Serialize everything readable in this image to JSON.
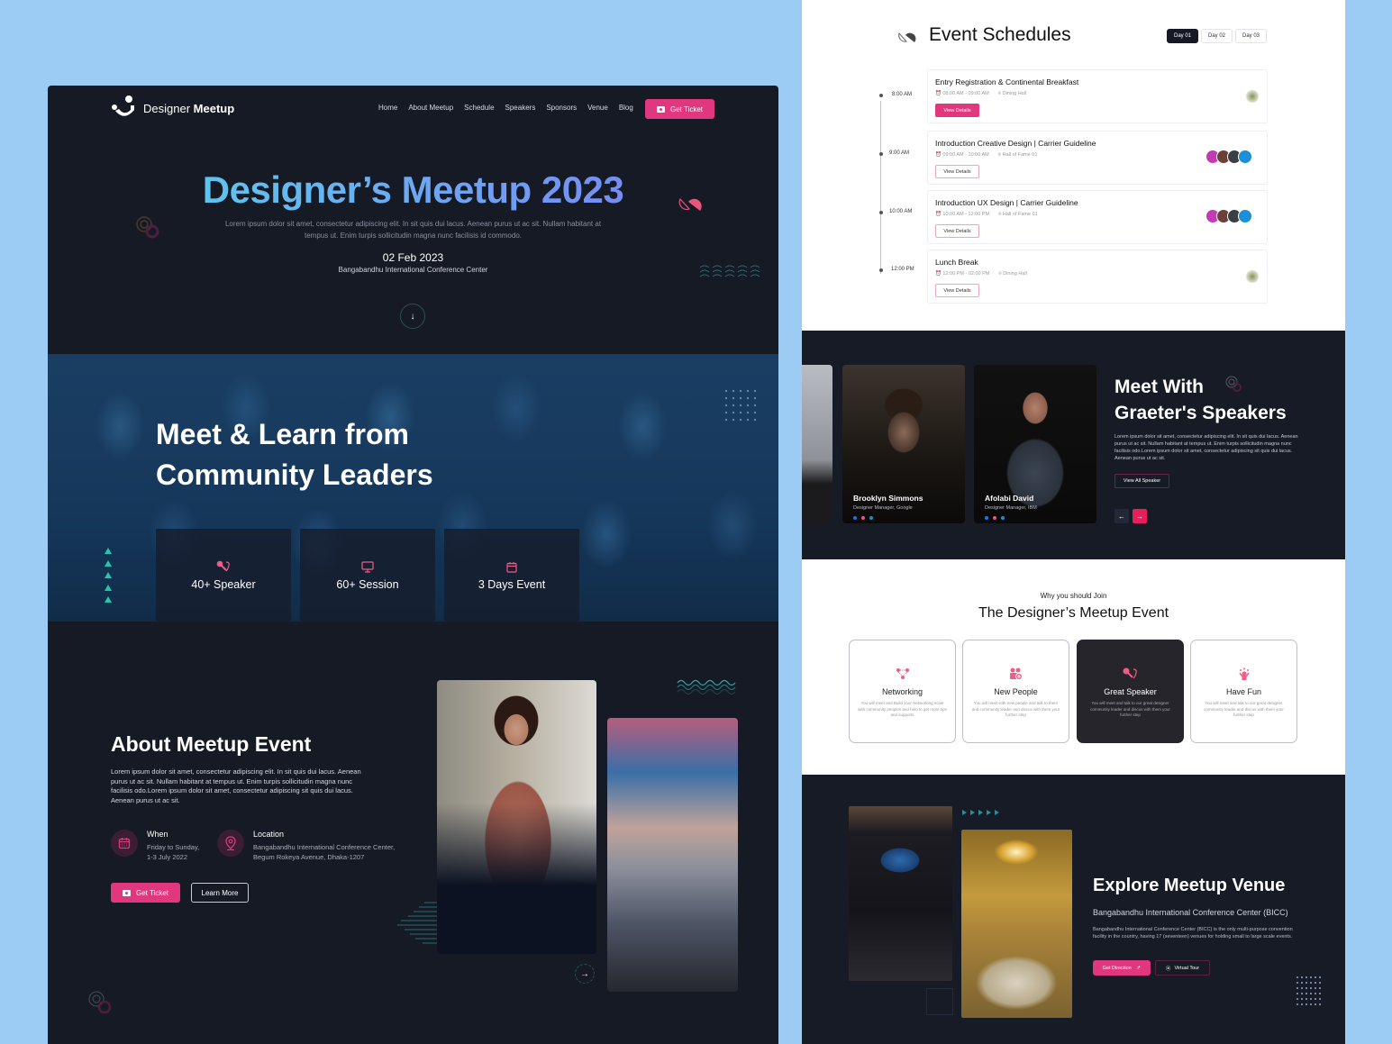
{
  "brand": {
    "prefix": "Designer",
    "bold": "Meetup"
  },
  "nav": {
    "items": [
      "Home",
      "About Meetup",
      "Schedule",
      "Speakers",
      "Sponsors",
      "Venue",
      "Blog"
    ],
    "cta": "Get Ticket"
  },
  "hero": {
    "title": "Designer’s Meetup 2023",
    "subtitle": "Lorem ipsum dolor sit amet, consectetur adipiscing elit. In sit quis dui lacus. Aenean purus ut ac sit. Nullam habitant at tempus ut. Enim turpis sollicitudin magna nunc facilisis id commodo.",
    "date": "02 Feb 2023",
    "location": "Bangabandhu International Conference Center",
    "scroll_icon": "arrow-down-icon"
  },
  "community": {
    "title_line1": "Meet & Learn from",
    "title_line2": "Community Leaders",
    "stats": [
      {
        "icon": "microphone-icon",
        "label": "40+ Speaker"
      },
      {
        "icon": "monitor-icon",
        "label": "60+ Session"
      },
      {
        "icon": "calendar-icon",
        "label": "3 Days Event"
      }
    ]
  },
  "about": {
    "title": "About Meetup Event",
    "text": "Lorem ipsum dolor sit amet, consectetur adipiscing elit. In sit quis dui lacus. Aenean purus ut ac sit. Nullam habitant at tempus ut. Enim turpis sollicitudin magna nunc facilisis odo.Lorem ipsum dolor sit amet, consectetur adipiscing sit quis dui lacus. Aenean purus ut ac sit.",
    "when_label": "When",
    "when_line1": "Friday to Sunday,",
    "when_line2": "1-3 July 2022",
    "location_label": "Location",
    "location_line1": "Bangabandhu International Conference Center,",
    "location_line2": "Begum Rokeya Avenue, Dhaka-1207",
    "ticket_button": "Get Ticket",
    "learn_button": "Learn More"
  },
  "schedule": {
    "title": "Event Schedules",
    "days": [
      "Day 01",
      "Day 02",
      "Day 03"
    ],
    "active_day": "Day 01",
    "items": [
      {
        "time": "8:00 AM",
        "title": "Entry Registration & Continental Breakfast",
        "range": "08:00 AM - 09:00 AM",
        "place": "Dining Hall",
        "button": "View Details"
      },
      {
        "time": "9:00 AM",
        "title": "Introduction Creative Design | Carrier Guideline",
        "range": "09:00 AM - 10:00 AM",
        "place": "Hall of Fame 01",
        "button": "View Details"
      },
      {
        "time": "10:00 AM",
        "title": "Introduction UX Design | Carrier Guideline",
        "range": "10:00 AM - 12:00 PM",
        "place": "Hall of Fame 01",
        "button": "View Details"
      },
      {
        "time": "12:00 PM",
        "title": "Lunch Break",
        "range": "12:00 PM - 02:00 PM",
        "place": "Dining Hall",
        "button": "View Details"
      }
    ]
  },
  "speakers": {
    "title_line1": "Meet With",
    "title_line2": "Graeter's Speakers",
    "text": "Lorem ipsum dolor sit amet, consectetur adipiscing elit. In sit quis dui lacus. Aenean purus ut ac sit. Nullam habitant at tempus ut. Enim turpis sollicitudin magna nunc facilisis odo.Lorem ipsum dolor sit amet, consectetur adipiscing sit quis dui lacus. Aenean purus ut ac sit.",
    "view_all": "View All Speaker",
    "cards": [
      {
        "name": "Brooklyn Simmons",
        "role": "Designer Manager, Google"
      },
      {
        "name": "Afolabi David",
        "role": "Designer Manager, IBM"
      }
    ]
  },
  "why": {
    "subtitle": "Why you should Join",
    "title": "The Designer’s Meetup Event",
    "features": [
      {
        "icon": "network-icon",
        "title": "Networking",
        "text": "You will meet and Build your Networking scale with community peoples and helo to get more tips and supports"
      },
      {
        "icon": "people-add-icon",
        "title": "New People",
        "text": "You will meet with new people and talk to them and community leader and discus with them your further step"
      },
      {
        "icon": "microphone-icon",
        "title": "Great Speaker",
        "text": "You will meet and talk to our great designer community leader and discus with them your further step"
      },
      {
        "icon": "celebration-icon",
        "title": "Have Fun",
        "text": "You will meet and talk to our great designer community leader and discus with them your further step"
      }
    ]
  },
  "venue": {
    "title": "Explore Meetup Venue",
    "subtitle": "Bangabandhu International Conference Center (BICC)",
    "text": "Bangabandhu International Conference Center (BICC) is the only multi-purpose convention facility in the country, having 17 (seventeen) venues for holding small to large scale events.",
    "direction_button": "Get Direction",
    "tour_button": "Virtual Tour"
  },
  "colors": {
    "accent": "#e0377f",
    "dark": "#161a25",
    "teal": "#25c5b0",
    "backdrop": "#9ccbf3"
  }
}
